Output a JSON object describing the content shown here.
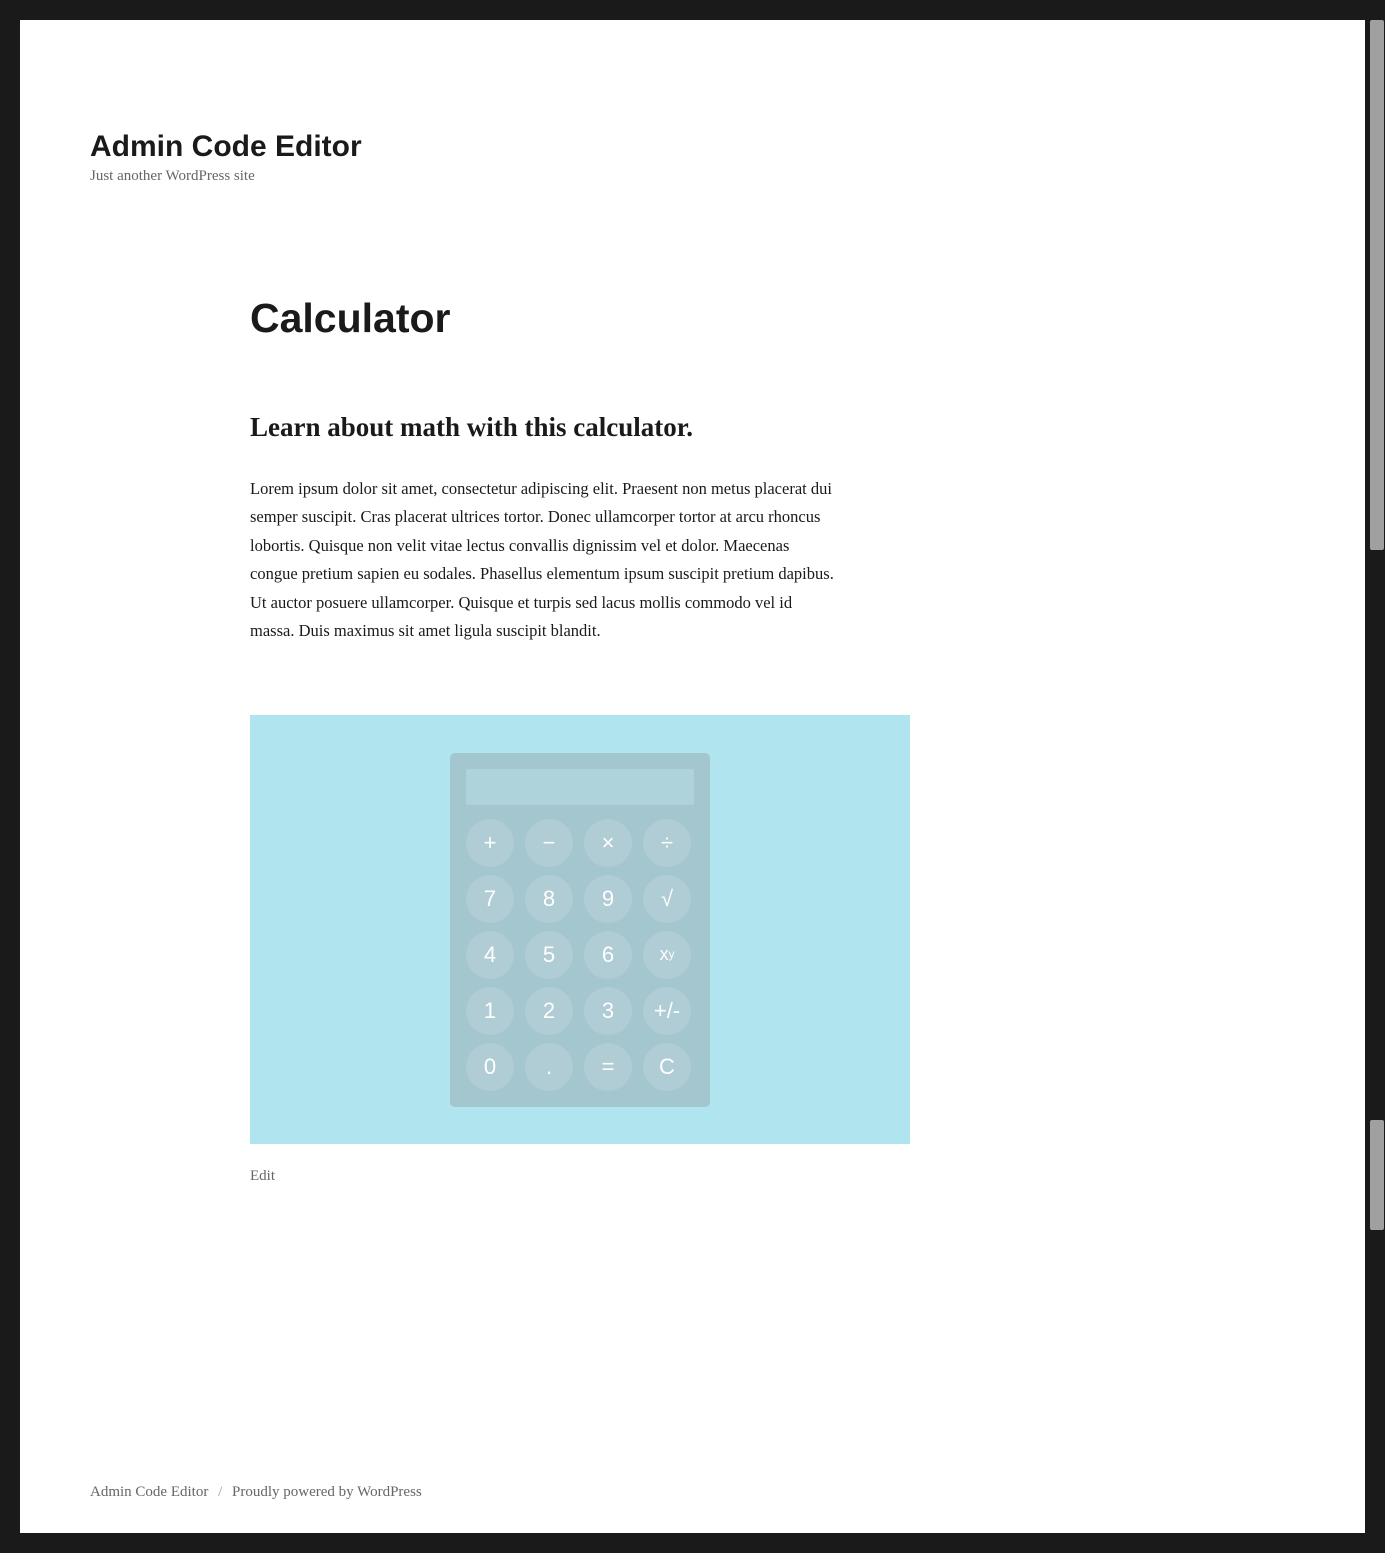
{
  "site": {
    "title": "Admin Code Editor",
    "tagline": "Just another WordPress site"
  },
  "post": {
    "title": "Calculator",
    "subheading": "Learn about math with this calculator.",
    "body": "Lorem ipsum dolor sit amet, consectetur adipiscing elit. Praesent non metus placerat dui semper suscipit. Cras placerat ultrices tortor. Donec ullamcorper tortor at arcu rhoncus lobortis. Quisque non velit vitae lectus convallis dignissim vel et dolor. Maecenas congue pretium sapien eu sodales. Phasellus elementum ipsum suscipit pretium dapibus. Ut auctor posuere ullamcorper. Quisque et turpis sed lacus mollis commodo vel id massa. Duis maximus sit amet ligula suscipit blandit.",
    "editLabel": "Edit"
  },
  "calculator": {
    "display": "",
    "buttons": [
      {
        "label": "+",
        "name": "add"
      },
      {
        "label": "−",
        "name": "subtract"
      },
      {
        "label": "×",
        "name": "multiply"
      },
      {
        "label": "÷",
        "name": "divide"
      },
      {
        "label": "7",
        "name": "seven"
      },
      {
        "label": "8",
        "name": "eight"
      },
      {
        "label": "9",
        "name": "nine"
      },
      {
        "label": "√",
        "name": "sqrt"
      },
      {
        "label": "4",
        "name": "four"
      },
      {
        "label": "5",
        "name": "five"
      },
      {
        "label": "6",
        "name": "six"
      },
      {
        "label": "xʸ",
        "name": "power"
      },
      {
        "label": "1",
        "name": "one"
      },
      {
        "label": "2",
        "name": "two"
      },
      {
        "label": "3",
        "name": "three"
      },
      {
        "label": "+/-",
        "name": "negate"
      },
      {
        "label": "0",
        "name": "zero"
      },
      {
        "label": ".",
        "name": "decimal"
      },
      {
        "label": "=",
        "name": "equals"
      },
      {
        "label": "C",
        "name": "clear"
      }
    ]
  },
  "footer": {
    "siteLink": "Admin Code Editor",
    "separator": "/",
    "poweredBy": "Proudly powered by WordPress"
  }
}
